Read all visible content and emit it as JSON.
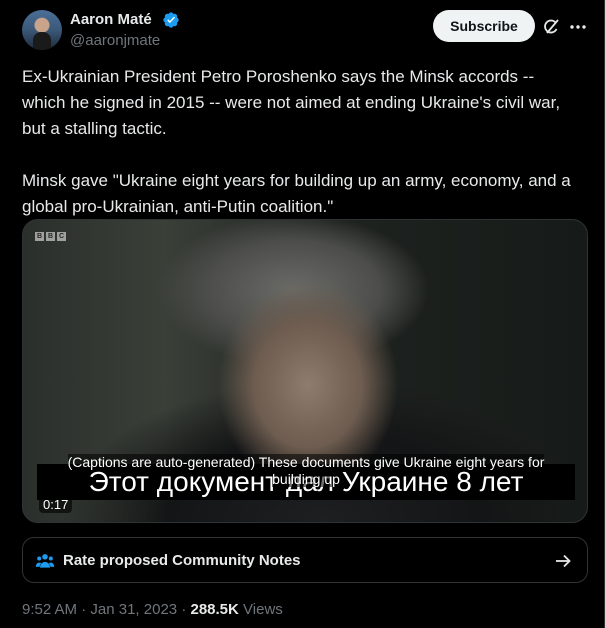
{
  "author": {
    "name": "Aaron Maté",
    "handle": "@aaronjmate"
  },
  "actions": {
    "subscribe_label": "Subscribe"
  },
  "tweet": {
    "paragraph1": "Ex-Ukrainian President Petro Poroshenko says the Minsk accords --\nwhich he signed in 2015 -- were not aimed at ending Ukraine's civil war,\nbut a stalling tactic.",
    "paragraph2": "Minsk gave \"Ukraine eight years for building up an army, economy, and a\nglobal pro-Ukrainian, anti-Putin coalition.\""
  },
  "video": {
    "watermark": "BBC",
    "ru_caption": "Этот документ дал Украине 8 лет",
    "auto_caption": "(Captions are auto-generated) These documents give Ukraine eight years for building up",
    "duration": "0:17"
  },
  "community_notes": {
    "label": "Rate proposed Community Notes"
  },
  "meta": {
    "time": "9:52 AM",
    "date": "Jan 31, 2023",
    "views_count": "288.5K",
    "views_label": "Views"
  },
  "colors": {
    "background": "#000000",
    "text": "#e7e9ea",
    "muted": "#71767b",
    "verified": "#1d9bf0",
    "notes_icon": "#1d9bf0"
  }
}
